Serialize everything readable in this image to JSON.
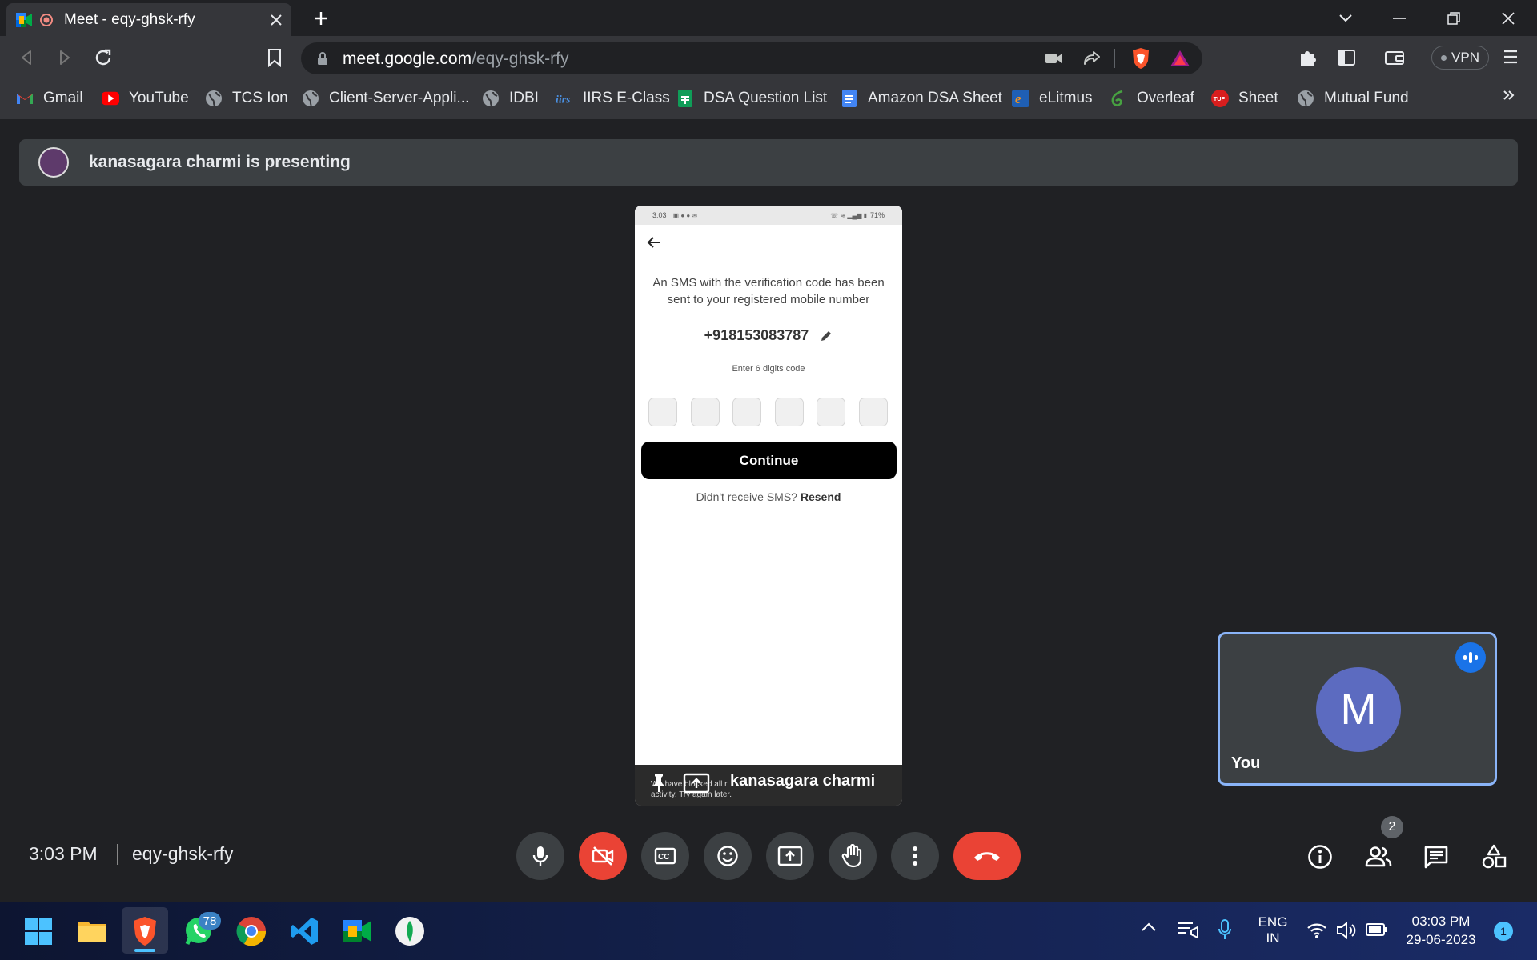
{
  "browser": {
    "tab_title": "Meet - eqy-ghsk-rfy",
    "url_host": "meet.google.com",
    "url_path": "/eqy-ghsk-rfy",
    "vpn_label": "VPN"
  },
  "bookmarks": [
    {
      "label": "Gmail",
      "icon": "gmail-icon"
    },
    {
      "label": "YouTube",
      "icon": "youtube-icon"
    },
    {
      "label": "TCS Ion",
      "icon": "globe-icon"
    },
    {
      "label": "Client-Server-Appli...",
      "icon": "globe-icon"
    },
    {
      "label": "IDBI",
      "icon": "globe-icon"
    },
    {
      "label": "IIRS E-Class",
      "icon": "iirs-icon"
    },
    {
      "label": "DSA Question List",
      "icon": "sheets-icon"
    },
    {
      "label": "Amazon DSA Sheet",
      "icon": "docs-icon"
    },
    {
      "label": "eLitmus",
      "icon": "elitmus-icon"
    },
    {
      "label": "Overleaf",
      "icon": "overleaf-icon"
    },
    {
      "label": "Sheet",
      "icon": "tuf-icon"
    },
    {
      "label": "Mutual Fund",
      "icon": "globe-icon"
    }
  ],
  "meet": {
    "presenting_text": "kanasagara charmi is presenting",
    "presenter_name": "kanasagara charmi",
    "self_label": "You",
    "self_initial": "M",
    "time": "3:03 PM",
    "meeting_code": "eqy-ghsk-rfy",
    "people_count": "2"
  },
  "phone": {
    "status_time": "3:03",
    "status_battery": "71%",
    "sms_message": "An SMS with the verification code has been sent to your registered mobile number",
    "phone_number": "+918153083787",
    "enter_code_hint": "Enter 6 digits code",
    "continue_label": "Continue",
    "didnt_receive": "Didn't receive SMS?",
    "resend_label": "Resend",
    "footer_text_1": "We have blocked all r",
    "footer_text_2": "activity. Try again later."
  },
  "taskbar": {
    "whatsapp_badge": "78",
    "lang_1": "ENG",
    "lang_2": "IN",
    "clock_time": "03:03 PM",
    "clock_date": "29-06-2023",
    "notification_count": "1"
  },
  "colors": {
    "end_call": "#ea4335",
    "cam_off": "#ea4335",
    "meet_blue": "#8ab4f8",
    "avatar_bg": "#5c6bc0"
  }
}
